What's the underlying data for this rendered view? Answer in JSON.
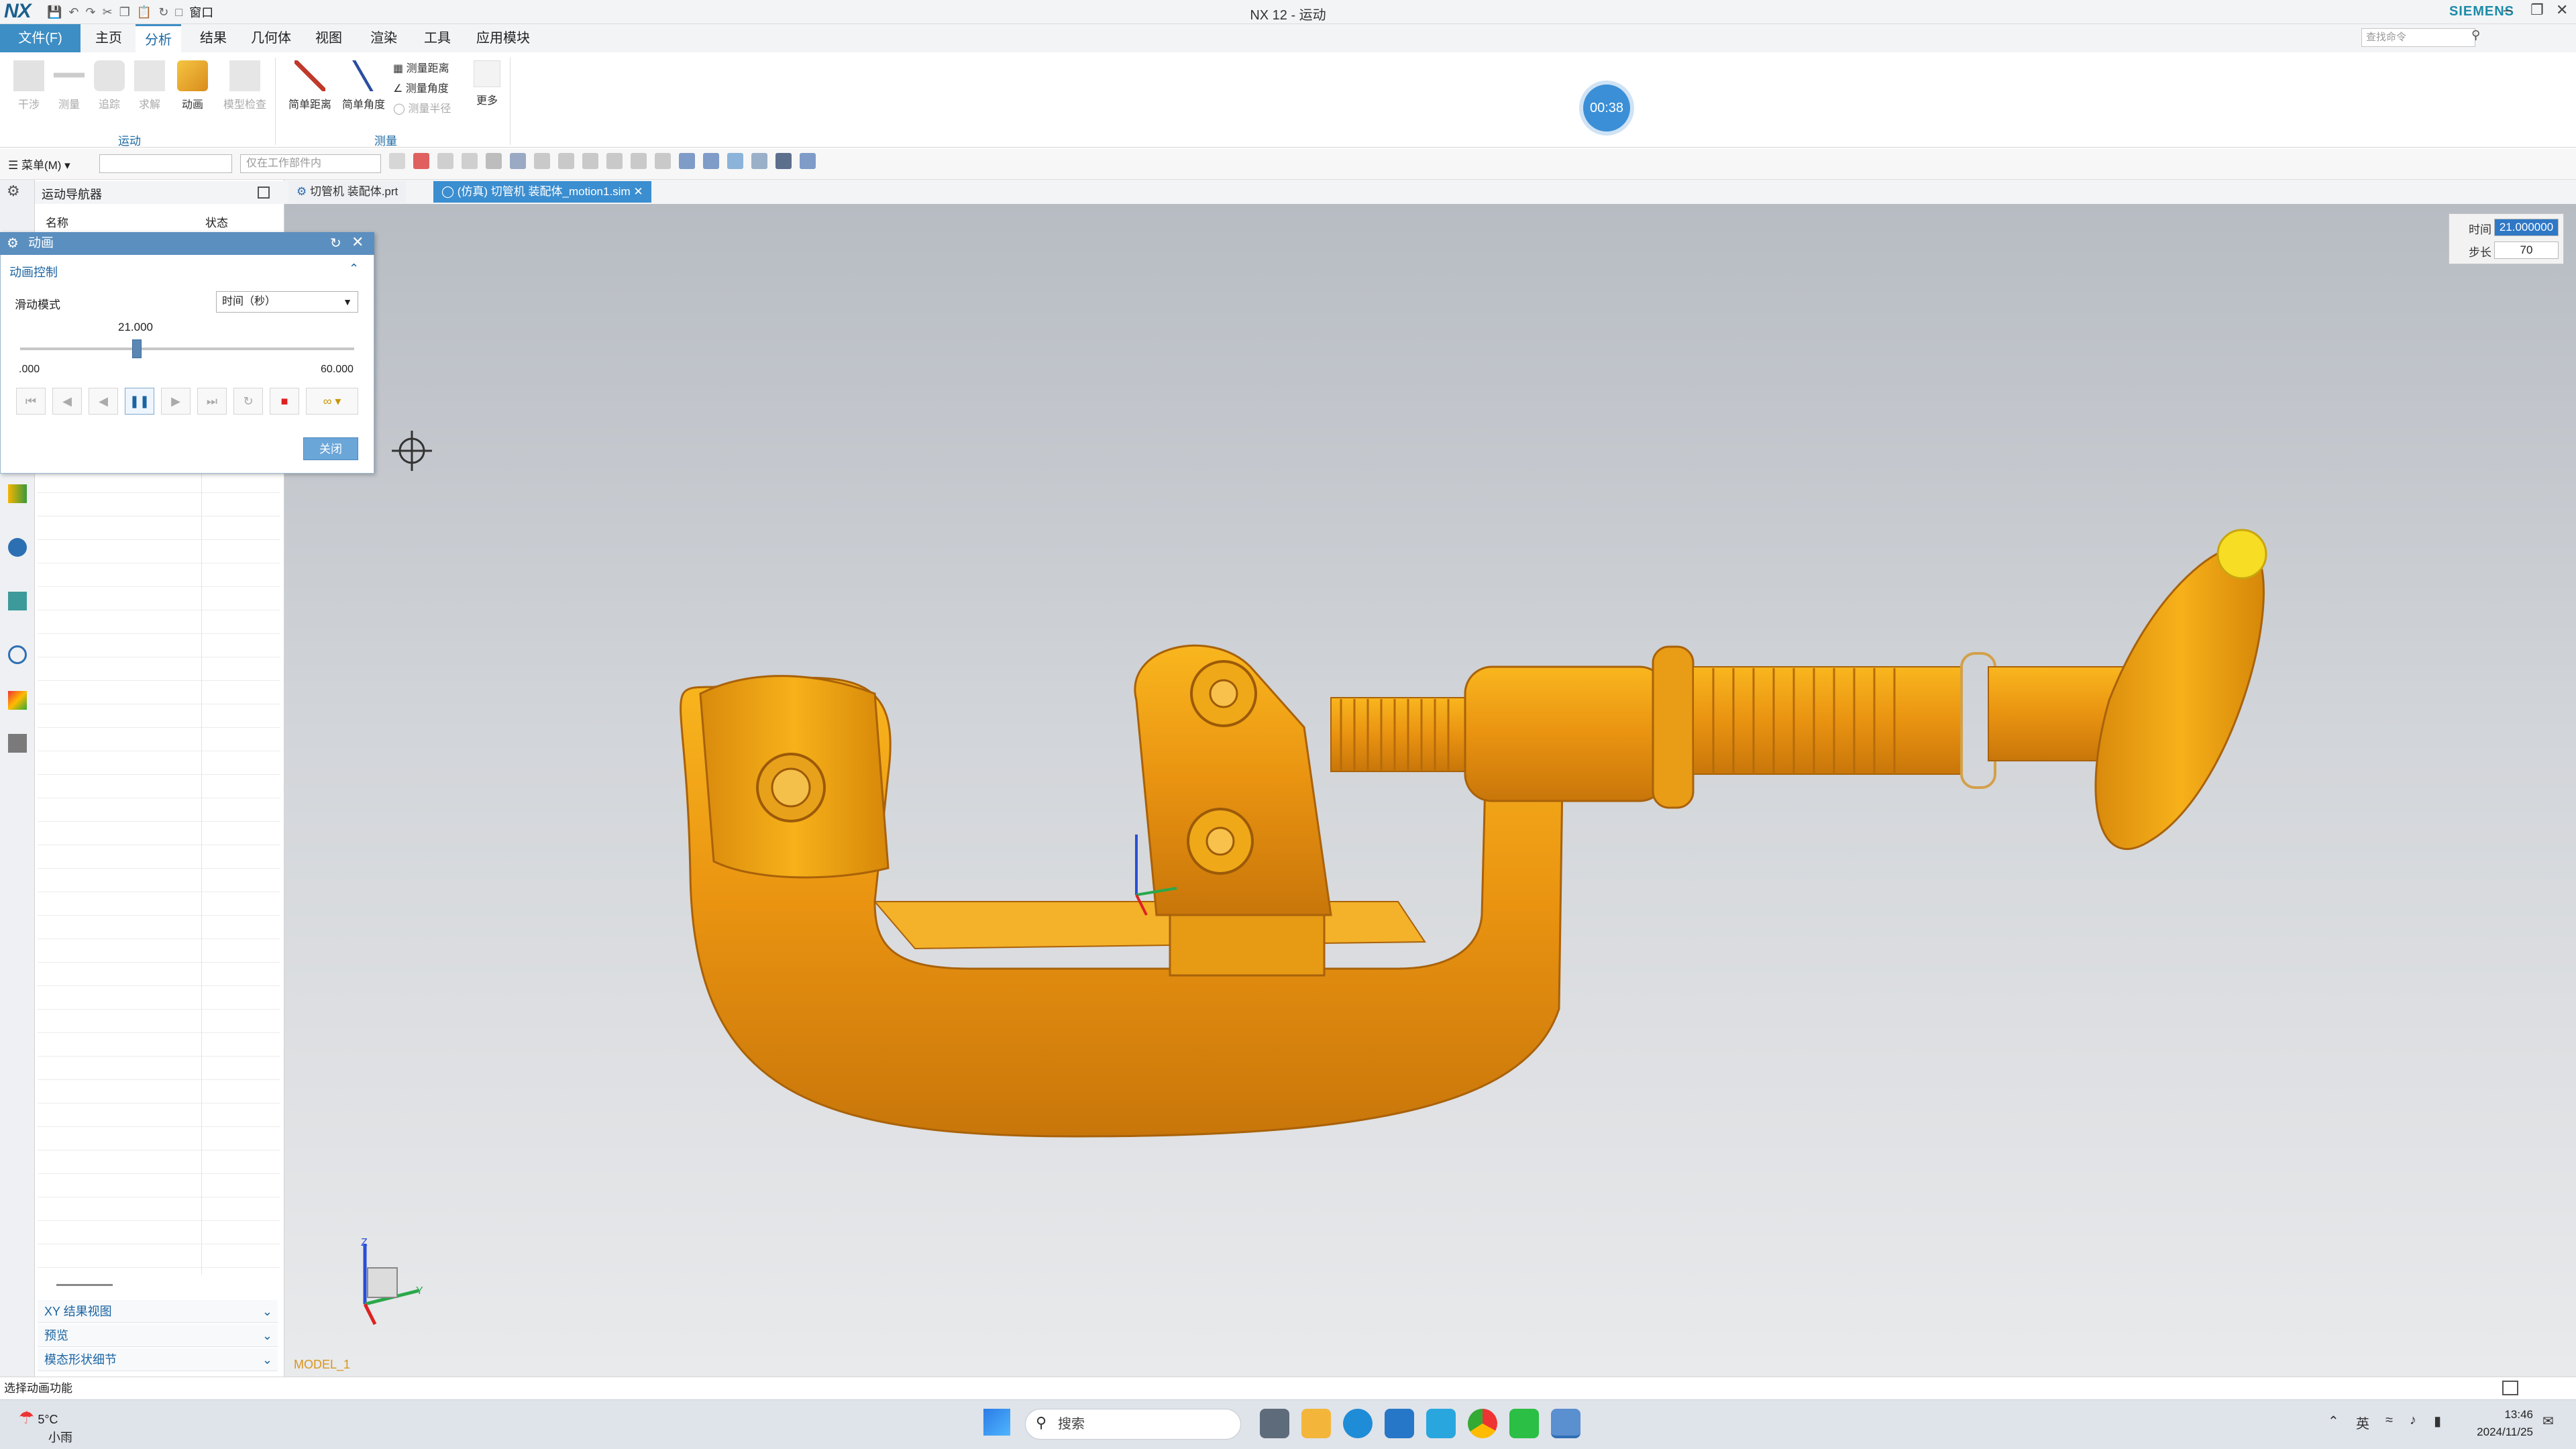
{
  "window": {
    "logo": "NX",
    "title": "NX 12 - 运动",
    "brand": "SIEMENS",
    "window_menu": "窗口",
    "search_placeholder": "查找命令"
  },
  "menu": {
    "file": "文件(F)",
    "tabs": [
      "主页",
      "分析",
      "结果",
      "几何体",
      "视图",
      "渲染",
      "工具",
      "应用模块"
    ]
  },
  "ribbon": {
    "motion_buttons": [
      "干涉",
      "测量",
      "追踪",
      "求解",
      "动画",
      "模型检查"
    ],
    "measure_buttons": [
      "简单距离",
      "简单角度"
    ],
    "measure_small": [
      "测量距离",
      "测量角度",
      "测量半径"
    ],
    "more": "更多",
    "group_motion": "运动",
    "group_measure": "测量",
    "timer": "00:38"
  },
  "toolbar": {
    "menu_button": "菜单(M)",
    "filter_placeholder": "仅在工作部件内"
  },
  "tabs": {
    "tab1": "切管机 装配体.prt",
    "tab2": "(仿真) 切管机 装配体_motion1.sim"
  },
  "navigator": {
    "title": "运动导航器",
    "col_name": "名称",
    "col_status": "状态",
    "accordions": [
      "XY 结果视图",
      "预览",
      "模态形状细节"
    ]
  },
  "animation_dialog": {
    "title": "动画",
    "section": "动画控制",
    "slide_mode_label": "滑动模式",
    "slide_mode_value": "时间（秒）",
    "current": "21.000",
    "min": ".000",
    "max": "60.000",
    "position": 0.35,
    "close": "关闭"
  },
  "time_step": {
    "time_label": "时间",
    "time_value": "21.000000",
    "step_label": "步长",
    "step_value": "70"
  },
  "viewport": {
    "model_label": "MODEL_1",
    "model_color": "#f0a01a",
    "axis_labels": [
      "Z",
      "Y"
    ]
  },
  "status": {
    "text": "选择动画功能"
  },
  "taskbar": {
    "weather_temp": "5°C",
    "weather_desc": "小雨",
    "search": "搜索",
    "ime": "英",
    "time": "13:46",
    "date": "2024/11/25"
  }
}
